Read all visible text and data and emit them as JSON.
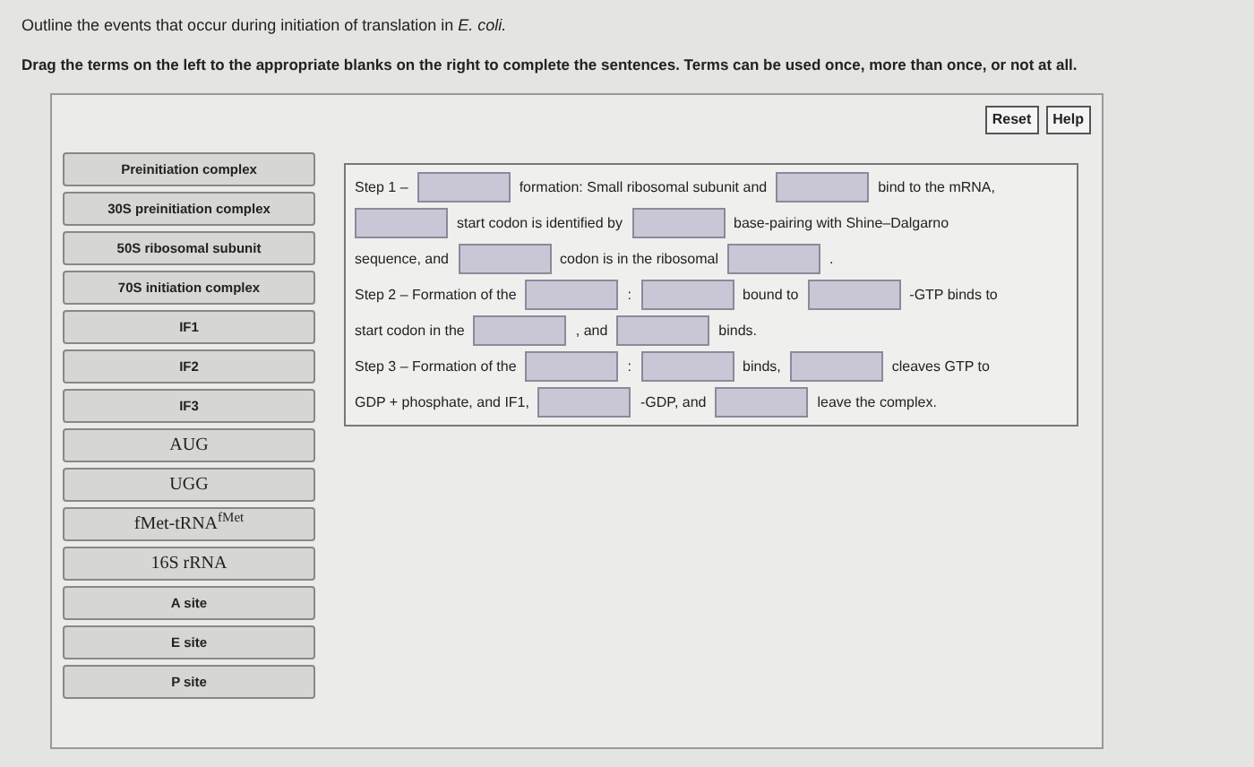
{
  "question": "Outline the events that occur during initiation of translation in *E. coli.*",
  "instructions": "Drag the terms on the left to the appropriate blanks on the right to complete the sentences. Terms can be used once, more than once, or not at all.",
  "buttons": [
    "Reset",
    "Help"
  ],
  "terms": [
    {
      "text": "Preinitiation complex",
      "kind": "label"
    },
    {
      "text": "30S preinitiation complex",
      "kind": "label"
    },
    {
      "text": "50S ribosomal subunit",
      "kind": "label"
    },
    {
      "text": "70S initiation complex",
      "kind": "label"
    },
    {
      "text": "IF1",
      "kind": "label"
    },
    {
      "text": "IF2",
      "kind": "label"
    },
    {
      "text": "IF3",
      "kind": "label"
    },
    {
      "text": "AUG",
      "kind": "formula"
    },
    {
      "text": "UGG",
      "kind": "formula"
    },
    {
      "text": "fMet-tRNA$^{fMet}$",
      "kind": "formula"
    },
    {
      "text": "16S rRNA",
      "kind": "formula"
    },
    {
      "text": "A site",
      "kind": "label"
    },
    {
      "text": "E site",
      "kind": "label"
    },
    {
      "text": "P site",
      "kind": "label"
    }
  ],
  "lines": [
    {
      "segments": [
        {
          "kind": "text",
          "text": "Step 1 –"
        },
        {
          "kind": "blank"
        },
        {
          "kind": "text",
          "text": "formation: Small ribosomal subunit and"
        },
        {
          "kind": "blank"
        },
        {
          "kind": "text",
          "text": "bind to the mRNA,"
        }
      ]
    },
    {
      "segments": [
        {
          "kind": "blank"
        },
        {
          "kind": "text",
          "text": "start codon is identified by"
        },
        {
          "kind": "blank"
        },
        {
          "kind": "text",
          "text": "base-pairing with Shine–Dalgarno"
        }
      ]
    },
    {
      "segments": [
        {
          "kind": "text",
          "text": "sequence, and"
        },
        {
          "kind": "blank"
        },
        {
          "kind": "text",
          "text": "codon is in the ribosomal"
        },
        {
          "kind": "blank"
        },
        {
          "kind": "text",
          "text": "."
        }
      ]
    },
    {
      "segments": [
        {
          "kind": "text",
          "text": "Step 2 – Formation of the"
        },
        {
          "kind": "blank"
        },
        {
          "kind": "text",
          "text": ":"
        },
        {
          "kind": "blank"
        },
        {
          "kind": "text",
          "text": "bound to"
        },
        {
          "kind": "blank"
        },
        {
          "kind": "text",
          "text": "-GTP binds to"
        }
      ]
    },
    {
      "segments": [
        {
          "kind": "text",
          "text": "start codon in the"
        },
        {
          "kind": "blank"
        },
        {
          "kind": "text",
          "text": ", and"
        },
        {
          "kind": "blank"
        },
        {
          "kind": "text",
          "text": "binds."
        }
      ]
    },
    {
      "segments": [
        {
          "kind": "text",
          "text": "Step 3 – Formation of the"
        },
        {
          "kind": "blank"
        },
        {
          "kind": "text",
          "text": ":"
        },
        {
          "kind": "blank"
        },
        {
          "kind": "text",
          "text": "binds,"
        },
        {
          "kind": "blank"
        },
        {
          "kind": "text",
          "text": "cleaves GTP to"
        }
      ]
    },
    {
      "segments": [
        {
          "kind": "text",
          "text": "GDP + phosphate, and IF1,"
        },
        {
          "kind": "blank"
        },
        {
          "kind": "text",
          "text": "-GDP, and"
        },
        {
          "kind": "blank"
        },
        {
          "kind": "text",
          "text": "leave the complex."
        }
      ]
    }
  ]
}
